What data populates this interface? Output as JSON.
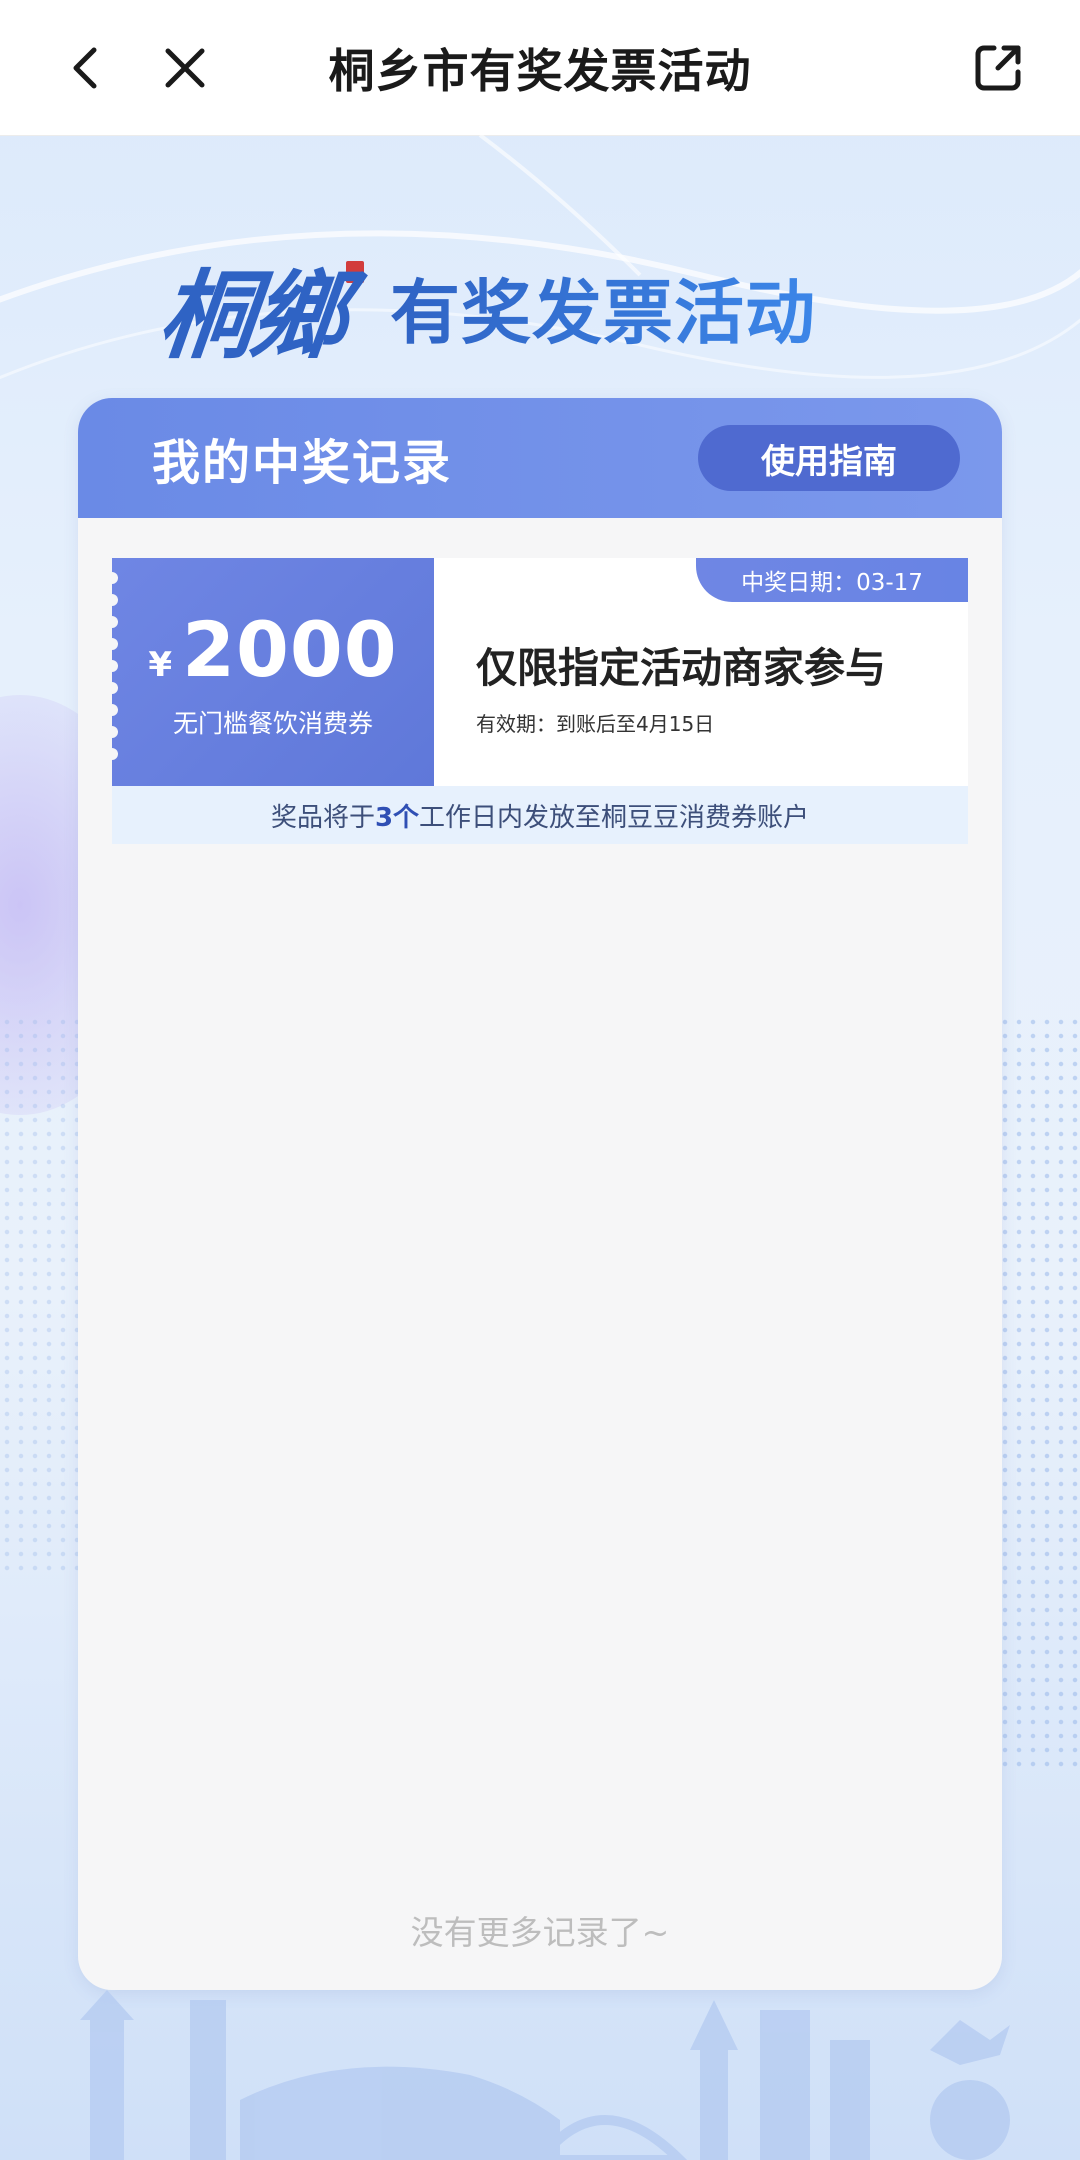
{
  "nav": {
    "title": "桐乡市有奖发票活动"
  },
  "banner": {
    "brand_script": "桐鄉",
    "title": "有奖发票活动"
  },
  "records": {
    "title": "我的中奖记录",
    "guide_button": "使用指南",
    "coupon": {
      "currency": "¥",
      "amount": "2000",
      "type": "无门槛餐饮消费券",
      "date_tag": "中奖日期：03-17",
      "description": "仅限指定活动商家参与",
      "validity": "有效期：到账后至4月15日",
      "notice_before": "奖品将于",
      "notice_highlight": "3个",
      "notice_after": "工作日内发放至桐豆豆消费券账户"
    },
    "no_more": "没有更多记录了~"
  },
  "colors": {
    "accent": "#6a8ae6",
    "accent_dark": "#4f6ad0",
    "brand_blue": "#2f63c4",
    "panel_bg": "#f6f6f7"
  },
  "icons": {
    "back": "chevron-left-icon",
    "close": "close-icon",
    "share": "share-external-icon"
  }
}
